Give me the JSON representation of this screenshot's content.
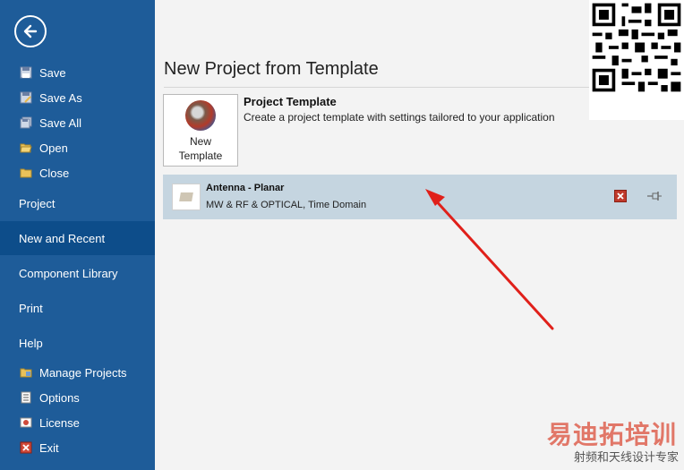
{
  "sidebar": {
    "items_top": [
      {
        "label": "Save",
        "icon": "save-icon"
      },
      {
        "label": "Save As",
        "icon": "save-as-icon"
      },
      {
        "label": "Save All",
        "icon": "save-all-icon"
      },
      {
        "label": "Open",
        "icon": "folder-open-icon"
      },
      {
        "label": "Close",
        "icon": "folder-close-icon"
      }
    ],
    "sections": [
      {
        "label": "Project"
      },
      {
        "label": "New and Recent"
      },
      {
        "label": "Component Library"
      },
      {
        "label": "Print"
      },
      {
        "label": "Help"
      }
    ],
    "items_bottom": [
      {
        "label": "Manage Projects",
        "icon": "manage-projects-icon"
      },
      {
        "label": "Options",
        "icon": "options-icon"
      },
      {
        "label": "License",
        "icon": "license-icon"
      },
      {
        "label": "Exit",
        "icon": "exit-icon"
      }
    ]
  },
  "main": {
    "title": "New Project from Template",
    "new_template": {
      "line1": "New",
      "line2": "Template"
    },
    "project_template": {
      "title": "Project Template",
      "description": "Create a project template with settings tailored to your application"
    },
    "recent": [
      {
        "title": "Antenna - Planar",
        "subtitle": "MW & RF & OPTICAL, Time Domain"
      }
    ]
  },
  "watermark": {
    "line1": "易迪拓培训",
    "line2": "射频和天线设计专家"
  },
  "colors": {
    "sidebar": "#1e5c99",
    "sidebar_active": "#0d4d8a",
    "recent_row": "#c5d5e0",
    "arrow": "#e0201a"
  }
}
